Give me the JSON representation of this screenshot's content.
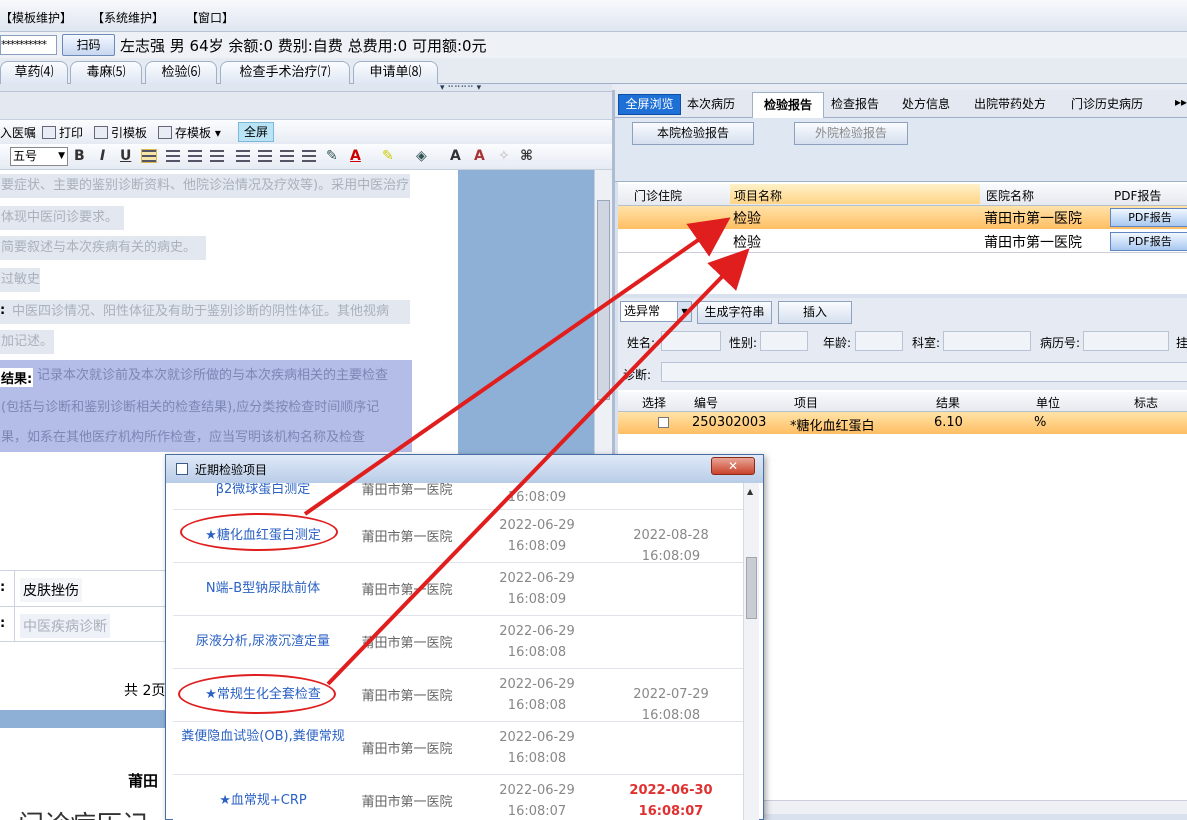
{
  "menu": [
    "【模板维护】",
    "【系统维护】",
    "【窗口】"
  ],
  "patient": {
    "password_mask": "**********",
    "scan_label": "扫码",
    "info": "左志强 男 64岁 余额:0 费别:自费 总费用:0 可用额:0元"
  },
  "left_tabs": [
    "草药⑷",
    "毒麻⑸",
    "检验⑹",
    "检查手术治疗⑺",
    "申请单⑻"
  ],
  "left_handle": "▾ ⠒⠒⠒⠒ ▾",
  "editor_toolbar": {
    "items": [
      "入医嘱",
      "打印",
      "引模板",
      "存模板"
    ],
    "fullscreen": "全屏",
    "font_size": "五号",
    "format": [
      "B",
      "I",
      "U"
    ]
  },
  "doc": {
    "lines": [
      "要症状、主要的鉴别诊断资料、他院诊治情况及疗效等)。采用中医治疗",
      "体现中医问诊要求。",
      "简要叙述与本次疾病有关的病史。",
      "过敏史",
      "中医四诊情况、阳性体征及有助于鉴别诊断的阴性体征。其他视病",
      "加记述。"
    ],
    "exam_label": "结果:",
    "exam_lines": [
      "记录本次就诊前及本次就诊所做的与本次疾病相关的主要检查",
      "(包括与诊断和鉴别诊断相关的检查结果),应分类按检查时间顺序记",
      "果，如系在其他医疗机构所作检查，应当写明该机构名称及检查"
    ],
    "field1_value": "皮肤挫伤",
    "field2_value": "中医疾病诊断",
    "page_count": "共 2页",
    "bottom_title": "莆田",
    "bottom_big": "门诊病历记"
  },
  "right_tabs": {
    "fullscreen": "全屏浏览",
    "items": [
      "本次病历",
      "检验报告",
      "检查报告",
      "处方信息",
      "出院带药处方",
      "门诊历史病历"
    ],
    "more": "▸▸"
  },
  "sub_buttons": [
    "本院检验报告",
    "外院检验报告"
  ],
  "report_grid": {
    "headers": [
      "门诊住院",
      "项目名称",
      "医院名称",
      "PDF报告"
    ],
    "rows": [
      {
        "type": "",
        "item": "检验",
        "hospital": "莆田市第一医院",
        "pdf": "PDF报告"
      },
      {
        "type": "",
        "item": "检验",
        "hospital": "莆田市第一医院",
        "pdf": "PDF报告"
      }
    ]
  },
  "result_toolbar": {
    "combo": "选异常",
    "gen_button": "生成字符串",
    "insert_button": "插入"
  },
  "result_form": {
    "labels": [
      "姓名:",
      "性别:",
      "年龄:",
      "科室:",
      "病历号:",
      "挂",
      "诊断:"
    ]
  },
  "result_grid": {
    "headers": [
      "选择",
      "编号",
      "项目",
      "结果",
      "单位",
      "标志"
    ],
    "rows": [
      {
        "code": "250302003",
        "item": "*糖化血红蛋白",
        "result": "6.10",
        "unit": "%",
        "flag": ""
      }
    ]
  },
  "popup": {
    "title": "近期检验项目",
    "close": "✕",
    "partial_top": {
      "name": "β2微球蛋白测定",
      "hospital": "莆田市第一医院",
      "time": "16:08:09"
    },
    "rows": [
      {
        "name": "★糖化血红蛋白测定",
        "hospital": "莆田市第一医院",
        "date": "2022-06-29",
        "time": "16:08:09",
        "next": "2022-08-28 16:08:09",
        "next_red": false
      },
      {
        "name": "N端-B型钠尿肽前体",
        "hospital": "莆田市第一医院",
        "date": "2022-06-29",
        "time": "16:08:09",
        "next": "",
        "next_red": false
      },
      {
        "name": "尿液分析,尿液沉渣定量",
        "hospital": "莆田市第一医院",
        "date": "2022-06-29",
        "time": "16:08:08",
        "next": "",
        "next_red": false
      },
      {
        "name": "★常规生化全套检查",
        "hospital": "莆田市第一医院",
        "date": "2022-06-29",
        "time": "16:08:08",
        "next": "2022-07-29 16:08:08",
        "next_red": false
      },
      {
        "name": "粪便隐血试验(OB),粪便常规",
        "hospital": "莆田市第一医院",
        "date": "2022-06-29",
        "time": "16:08:08",
        "next": "",
        "next_red": false
      },
      {
        "name": "★血常规+CRP",
        "hospital": "莆田市第一医院",
        "date": "2022-06-29",
        "time": "16:08:07",
        "next": "2022-06-30 16:08:07",
        "next_red": true
      }
    ]
  },
  "colors": {
    "annotation": "#e01e1e",
    "selected_row": "#ffbe63",
    "link_blue": "#2b62c4",
    "overdue_red": "#e03030"
  }
}
